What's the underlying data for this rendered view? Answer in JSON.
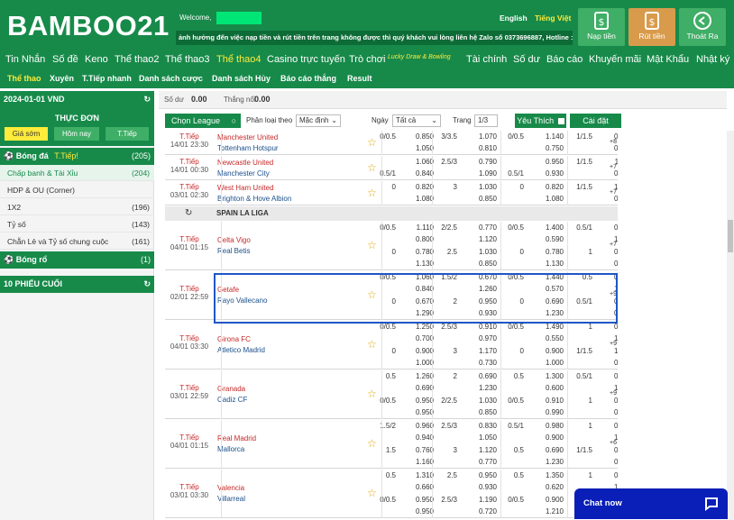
{
  "header": {
    "logo": "BAMBOO21",
    "welcome": "Welcome,",
    "lang_en": "English",
    "lang_vi": "Tiếng Việt",
    "marquee": "ảnh hưởng đến việc nạp tiền và rút tiền trên trang không được thì quý khách vui lòng liên hệ Zalo số 0373696887, Hotline :",
    "btn_deposit": "Nạp tiền",
    "btn_withdraw": "Rút tiền",
    "btn_logout": "Thoát Ra",
    "colors": {
      "brand": "#178a4a",
      "withdraw": "#d89b4c",
      "accent_nav": "#ffeb3b"
    }
  },
  "nav": {
    "items": [
      "Tin Nhắn",
      "Số đề",
      "Keno",
      "Thể thao2",
      "Thể thao3",
      "Thể thao4",
      "Casino trực tuyến",
      "Trò chơi",
      "Lucky Draw & Bowling",
      "Tài chính",
      "Số dư",
      "Báo cáo",
      "Khuyến mãi",
      "Mật Khẩu",
      "Nhật ký"
    ],
    "active": "Thể thao4"
  },
  "subnav": {
    "items": [
      "Thể thao",
      "Xuyên",
      "T.Tiếp nhanh",
      "Danh sách cược",
      "Danh sách Hủy",
      "Báo cáo thắng",
      "Result"
    ],
    "active": "Thể thao"
  },
  "sidebar": {
    "balance_date": "2024-01-01 VND",
    "menu_title": "THỰC ĐƠN",
    "tabs": [
      "Giá sớm",
      "Hôm nay",
      "T.Tiếp"
    ],
    "football": {
      "label": "Bóng đá",
      "live": "T.Tiếp!",
      "count": "(205)"
    },
    "items": [
      {
        "label": "Chấp banh & Tài Xỉu",
        "count": "(204)"
      },
      {
        "label": "HDP & OU (Corner)",
        "count": ""
      },
      {
        "label": "1X2",
        "count": "(196)"
      },
      {
        "label": "Tỷ số",
        "count": "(143)"
      },
      {
        "label": "Chẵn Lẻ và Tỷ số chung cuộc",
        "count": "(161)"
      }
    ],
    "basketball": {
      "label": "Bóng rổ",
      "count": "(1)"
    },
    "recent": "10 PHIẾU CUỐI"
  },
  "topbar": {
    "balance_label": "Số dư",
    "balance": "0.00",
    "winloss_label": "Thắng nổi",
    "winloss": "0.00"
  },
  "toolbar": {
    "choose_league": "Chọn League",
    "sort_label": "Phân loại theo",
    "sort_value": "Mặc định",
    "day_label": "Ngày",
    "day_value": "Tất cả",
    "page_label": "Trang",
    "page_value": "1/3",
    "favorite": "Yêu Thích",
    "settings": "Cài đặt"
  },
  "league_spain": "SPAIN LA LIGA",
  "matches": [
    {
      "status": "T.Tiếp",
      "date": "14/01 23:30",
      "home": "Manchester United",
      "away": "Tottenham Hotspur",
      "more": "+8",
      "r": [
        [
          "0/0.5",
          "0.850",
          "3/3.5",
          "1.070",
          "0/0.5",
          "1.140",
          "1/1.5",
          "0.900"
        ],
        [
          "",
          "1.050",
          "",
          "0.810",
          "",
          "0.750",
          "",
          "0.980"
        ]
      ]
    },
    {
      "status": "T.Tiếp",
      "date": "14/01 00:30",
      "home": "Newcastle United",
      "away": "Manchester City",
      "more": "+7",
      "r": [
        [
          "",
          "1.060",
          "2.5/3",
          "0.790",
          "",
          "0.950",
          "1/1.5",
          "1.110"
        ],
        [
          "0.5/1",
          "0.840",
          "",
          "1.090",
          "0.5/1",
          "0.930",
          "",
          "0.770"
        ]
      ]
    },
    {
      "status": "T.Tiếp",
      "date": "03/01 02:30",
      "home": "West Ham United",
      "away": "Brighton & Hove Albion",
      "more": "+7",
      "r": [
        [
          "0",
          "0.820",
          "3",
          "1.030",
          "0",
          "0.820",
          "1/1.5",
          "1.010"
        ],
        [
          "",
          "1.080",
          "",
          "0.850",
          "",
          "1.080",
          "",
          "0.870"
        ]
      ]
    },
    {
      "status": "T.Tiếp",
      "date": "04/01 01:15",
      "home": "Celta Vigo",
      "away": "Real Betis",
      "more": "+7",
      "r": [
        [
          "0/0.5",
          "1.110",
          "2/2.5",
          "0.770",
          "0/0.5",
          "1.400",
          "0.5/1",
          "0.630"
        ],
        [
          "",
          "0.800",
          "",
          "1.120",
          "",
          "0.590",
          "",
          "1.330"
        ],
        [
          "0",
          "0.780",
          "2.5",
          "1.030",
          "0",
          "0.780",
          "1",
          "0.990"
        ],
        [
          "",
          "1.130",
          "",
          "0.850",
          "",
          "1.130",
          "",
          "0.890"
        ]
      ]
    },
    {
      "status": "T.Tiếp",
      "date": "02/01 22:59",
      "home": "Getafe",
      "away": "Rayo Vallecano",
      "more": "+9",
      "r": [
        [
          "0/0.5",
          "1.060",
          "1.5/2",
          "0.670",
          "0/0.5",
          "1.440",
          "0.5",
          "0.600"
        ],
        [
          "",
          "0.840",
          "",
          "1.260",
          "",
          "0.570",
          "",
          "1.380"
        ],
        [
          "0",
          "0.670",
          "2",
          "0.950",
          "0",
          "0.690",
          "0.5/1",
          "0.910"
        ],
        [
          "",
          "1.290",
          "",
          "0.930",
          "",
          "1.230",
          "",
          "0.970"
        ]
      ]
    },
    {
      "status": "T.Tiếp",
      "date": "04/01 03:30",
      "home": "Girona FC",
      "away": "Atletico Madrid",
      "more": "+9",
      "r": [
        [
          "0/0.5",
          "1.250",
          "2.5/3",
          "0.910",
          "0/0.5",
          "1.490",
          "1",
          "0.700"
        ],
        [
          "",
          "0.700",
          "",
          "0.970",
          "",
          "0.550",
          "",
          "1.210"
        ],
        [
          "0",
          "0.900",
          "3",
          "1.170",
          "0",
          "0.900",
          "1/1.5",
          "1.170"
        ],
        [
          "",
          "1.000",
          "",
          "0.730",
          "",
          "1.000",
          "",
          "0.760"
        ]
      ]
    },
    {
      "status": "T.Tiếp",
      "date": "03/01 22:59",
      "home": "Granada",
      "away": "Cadiz CF",
      "more": "+9",
      "r": [
        [
          "0.5",
          "1.260",
          "2",
          "0.690",
          "0.5",
          "1.300",
          "0.5/1",
          "0.680"
        ],
        [
          "",
          "0.690",
          "",
          "1.230",
          "",
          "0.600",
          "",
          "1.250"
        ],
        [
          "0/0.5",
          "0.950",
          "2/2.5",
          "1.030",
          "0/0.5",
          "0.910",
          "1",
          "0.970"
        ],
        [
          "",
          "0.950",
          "",
          "0.850",
          "",
          "0.990",
          "",
          "0.930"
        ]
      ]
    },
    {
      "status": "T.Tiếp",
      "date": "04/01 01:15",
      "home": "Real Madrid",
      "away": "Mallorca",
      "more": "+6",
      "r": [
        [
          "1.5/2",
          "0.960",
          "2.5/3",
          "0.830",
          "0.5/1",
          "0.980",
          "1",
          "0.670"
        ],
        [
          "",
          "0.940",
          "",
          "1.050",
          "",
          "0.900",
          "",
          "1.260"
        ],
        [
          "1.5",
          "0.760",
          "3",
          "1.120",
          "0.5",
          "0.690",
          "1/1.5",
          "0.910"
        ],
        [
          "",
          "1.160",
          "",
          "0.770",
          "",
          "1.230",
          "",
          "0.970"
        ]
      ]
    },
    {
      "status": "T.Tiếp",
      "date": "03/01 03:30",
      "home": "Valencia",
      "away": "Villarreal",
      "more": "",
      "r": [
        [
          "0.5",
          "1.310",
          "2.5",
          "0.950",
          "0.5",
          "1.350",
          "1",
          "0.860"
        ],
        [
          "",
          "0.660",
          "",
          "0.930",
          "",
          "0.620",
          "",
          "1.030"
        ],
        [
          "0/0.5",
          "0.950",
          "2.5/3",
          "1.190",
          "0/0.5",
          "0.900",
          "1/1.5",
          "1.210"
        ],
        [
          "",
          "0.950",
          "",
          "0.720",
          "",
          "1.210",
          "",
          " "
        ]
      ]
    }
  ],
  "chat": "Chat now"
}
